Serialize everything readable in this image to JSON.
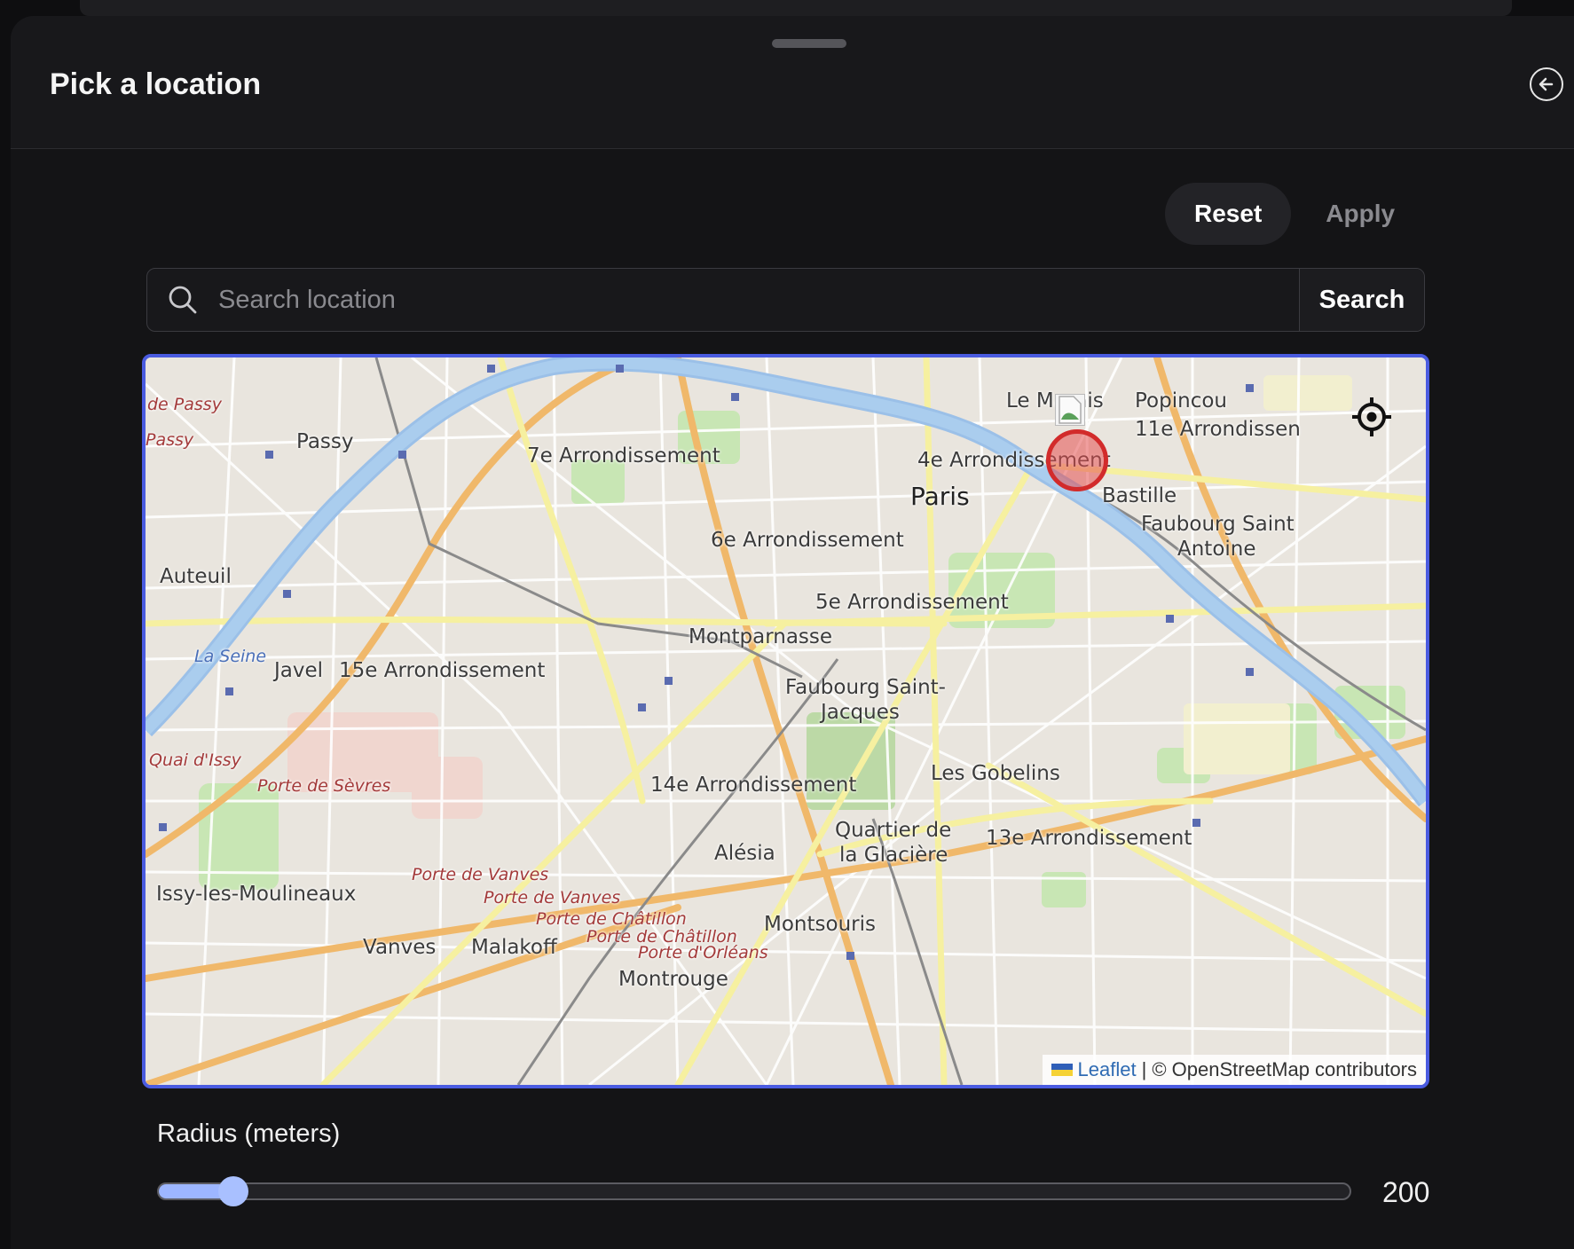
{
  "sheet": {
    "title": "Pick a location"
  },
  "actions": {
    "reset_label": "Reset",
    "apply_label": "Apply"
  },
  "search": {
    "placeholder": "Search location",
    "button_label": "Search"
  },
  "map": {
    "labels": {
      "de_passy": "de Passy",
      "passy_small": "Passy",
      "passy": "Passy",
      "arr7": "7e Arrondissement",
      "le_marais": "Le Marais",
      "popincourt": "Popincou",
      "arr11": "11e Arrondissen",
      "arr4": "4e Arrondissement",
      "paris": "Paris",
      "bastille": "Bastille",
      "faubourg_st_antoine_1": "Faubourg Saint",
      "faubourg_st_antoine_2": "Antoine",
      "auteuil": "Auteuil",
      "arr6": "6e Arrondissement",
      "arr5": "5e Arrondissement",
      "la_seine_w": "La Seine",
      "javel": "Javel",
      "arr15": "15e Arrondissement",
      "montparnasse": "Montparnasse",
      "faubourg_st_jacques_1": "Faubourg Saint-",
      "faubourg_st_jacques_2": "Jacques",
      "quai_issy": "Quai d'Issy",
      "porte_sevres": "Porte de Sèvres",
      "arr14": "14e Arrondissement",
      "les_gobelins": "Les Gobelins",
      "quartier_glaciere_1": "Quartier de",
      "quartier_glaciere_2": "la Glacière",
      "arr13": "13e Arrondissement",
      "alesia": "Alésia",
      "porte_vanves_1": "Porte de Vanves",
      "porte_vanves_2": "Porte de Vanves",
      "issy": "Issy-les-Moulineaux",
      "porte_chatillon_1": "Porte de Châtillon",
      "porte_chatillon_2": "Porte de Châtillon",
      "porte_orleans": "Porte d'Orléans",
      "montsouris": "Montsouris",
      "vanves": "Vanves",
      "malakoff": "Malakoff",
      "montrouge": "Montrouge"
    },
    "attribution": {
      "leaflet": "Leaflet",
      "separator": "|",
      "osm": "© OpenStreetMap contributors"
    },
    "icons": {
      "locate": "crosshair-locate-icon",
      "marker": "location-radius-marker"
    }
  },
  "radius": {
    "label": "Radius (meters)",
    "value": "200",
    "fill_fraction": 0.05
  },
  "colors": {
    "accent": "#4a5be0",
    "slider": "#9db6ff",
    "marker": "#d22b2b"
  }
}
